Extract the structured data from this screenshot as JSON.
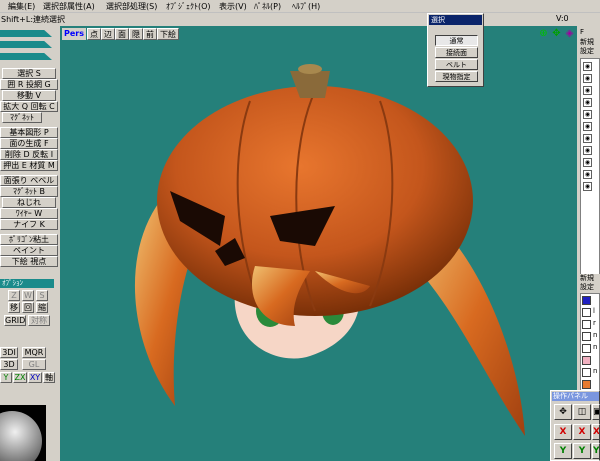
{
  "menu": {
    "items": [
      "編集(E)",
      "選択部属性(A)",
      "選択部処理(S)",
      "ｵﾌﾞｼﾞｪｸﾄ(O)",
      "表示(V)",
      "ﾊﾟﾈﾙ(P)",
      "ﾍﾙﾌﾟ(H)"
    ]
  },
  "hint": {
    "text": "Shift+L:連続選択",
    "version": "V:0"
  },
  "viewport": {
    "mode": "Pers",
    "tools": [
      "点",
      "辺",
      "面",
      "隠",
      "前",
      "下絵"
    ],
    "bg_color": "#25807a"
  },
  "left_tools": {
    "buttons": [
      "選択 S",
      "囲 R 投網 G",
      "移動 V",
      "拡大 Q 回転 C",
      "ﾏｸﾞﾈｯﾄ",
      "基本図形 P",
      "面の生成 F",
      "削除 D 反転 I",
      "押出 E 材質 M",
      "面張り ベベル",
      "ﾏｸﾞﾈｯﾄ B",
      "ねじれ",
      "ﾜｲﾔｰ W",
      "ナイフ K",
      "ﾎﾟﾘｺﾞﾝ粘土",
      "ペイント",
      "下絵 視点"
    ],
    "section_label": "ｵﾌﾟｼｮﾝ",
    "axis_row1": [
      "Z",
      "W",
      "S"
    ],
    "axis_row2": [
      "移",
      "回",
      "縮"
    ],
    "grid": "GRID",
    "grid2": "対称",
    "mode_row": [
      "3DI",
      "MQR"
    ],
    "mode_row2": [
      "3D",
      "GL"
    ],
    "xyz": [
      "Y",
      "ZX",
      "XY",
      "軸"
    ]
  },
  "select_popup": {
    "title": "選択",
    "buttons": [
      "通常",
      "接続面",
      "ベルト",
      "現物指定"
    ],
    "selected": "通常"
  },
  "right_panel": {
    "top_label": "F",
    "obj_header": "新規",
    "obj_subheader": "設定",
    "mat_header": "新規",
    "mat_subheader": "設定",
    "mat_items": [
      "",
      "l",
      "r",
      "n",
      "n",
      "",
      "n",
      ""
    ]
  },
  "op_panel": {
    "title": "操作パネル",
    "buttons": [
      "✥",
      "◫",
      "▣",
      "X",
      "X",
      "X",
      "Y",
      "Y",
      "Y"
    ]
  },
  "nav_icons": [
    "magnify-icon",
    "move-icon",
    "rotate-icon"
  ]
}
